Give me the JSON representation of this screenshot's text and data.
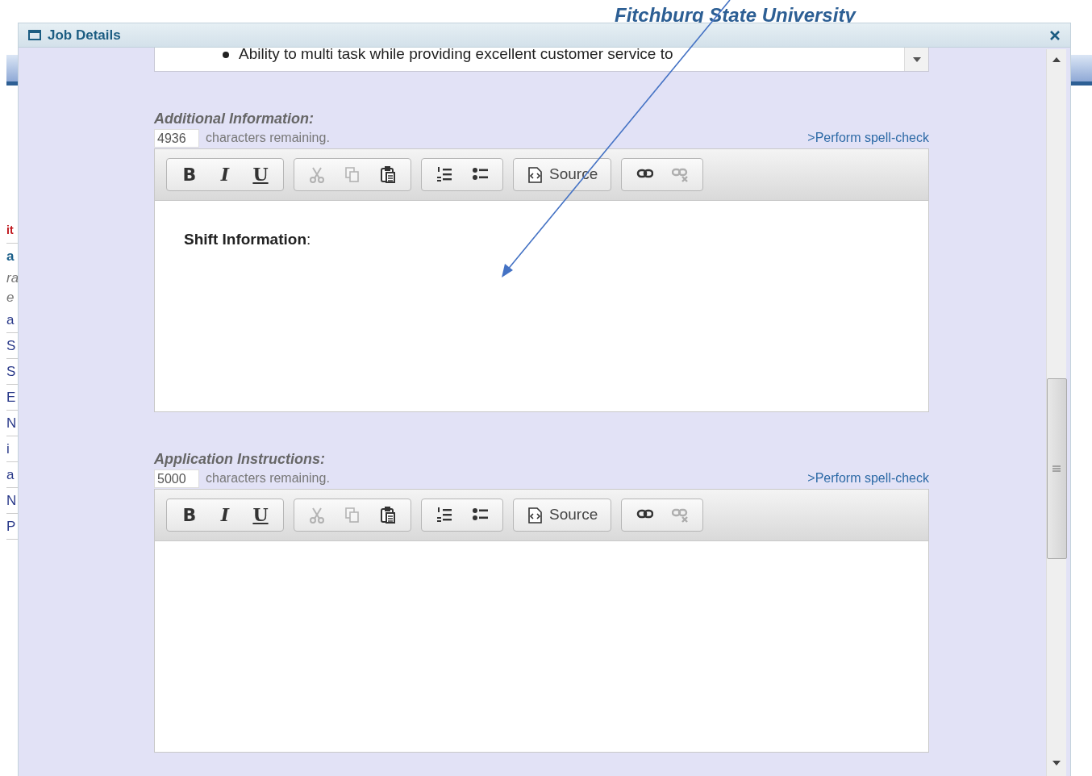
{
  "page": {
    "header": "Fitchburg State University",
    "side_fragments": [
      {
        "text": "it",
        "kind": "alert"
      },
      {
        "text": "a",
        "kind": "link"
      },
      {
        "text": "ra",
        "kind": "note"
      },
      {
        "text": "e",
        "kind": "note"
      },
      {
        "text": "a",
        "kind": "item"
      },
      {
        "text": "S",
        "kind": "item"
      },
      {
        "text": "S",
        "kind": "item"
      },
      {
        "text": "E",
        "kind": "item"
      },
      {
        "text": "N",
        "kind": "item"
      },
      {
        "text": "i",
        "kind": "item"
      },
      {
        "text": "a",
        "kind": "item"
      },
      {
        "text": "N",
        "kind": "item"
      },
      {
        "text": "P",
        "kind": "item"
      }
    ]
  },
  "dialog": {
    "title": "Job Details",
    "top_field": {
      "bullet": "Ability to multi task while providing excellent customer service to"
    },
    "editors": [
      {
        "label": "Additional Information:",
        "remaining": "4936",
        "remaining_text": "characters remaining.",
        "spellcheck": ">Perform spell-check",
        "content": "**Shift Information**:",
        "toolbar": [
          [
            {
              "kind": "bold",
              "label": "B",
              "disabled": false
            },
            {
              "kind": "italic",
              "label": "I",
              "disabled": false
            },
            {
              "kind": "underline",
              "label": "U",
              "disabled": false
            }
          ],
          [
            {
              "kind": "cut",
              "disabled": true
            },
            {
              "kind": "copy",
              "disabled": true
            },
            {
              "kind": "paste",
              "disabled": false
            }
          ],
          [
            {
              "kind": "numbered",
              "disabled": false
            },
            {
              "kind": "bulleted",
              "disabled": false
            }
          ],
          [
            {
              "kind": "source",
              "label": "Source",
              "disabled": false
            }
          ],
          [
            {
              "kind": "link",
              "disabled": false
            },
            {
              "kind": "unlink",
              "disabled": true
            }
          ]
        ]
      },
      {
        "label": "Application Instructions:",
        "remaining": "5000",
        "remaining_text": "characters remaining.",
        "spellcheck": ">Perform spell-check",
        "toolbar": [
          [
            {
              "kind": "bold",
              "label": "B",
              "disabled": false
            },
            {
              "kind": "italic",
              "label": "I",
              "disabled": false
            },
            {
              "kind": "underline",
              "label": "U",
              "disabled": false
            }
          ],
          [
            {
              "kind": "cut",
              "disabled": true
            },
            {
              "kind": "copy",
              "disabled": true
            },
            {
              "kind": "paste",
              "disabled": false
            }
          ],
          [
            {
              "kind": "numbered",
              "disabled": false
            },
            {
              "kind": "bulleted",
              "disabled": false
            }
          ],
          [
            {
              "kind": "source",
              "label": "Source",
              "disabled": false
            }
          ],
          [
            {
              "kind": "link",
              "disabled": false
            },
            {
              "kind": "unlink",
              "disabled": true
            }
          ]
        ]
      }
    ]
  }
}
